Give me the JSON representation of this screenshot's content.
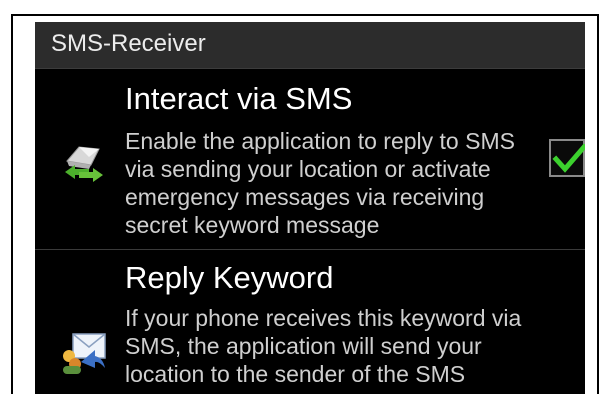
{
  "header": {
    "title": "SMS-Receiver"
  },
  "preferences": [
    {
      "title": "Interact via SMS",
      "summary": "Enable the application to reply to SMS\nvia sending your location or activate\nemergency messages via receiving\nsecret keyword message",
      "icon": "sms-exchange-icon",
      "checked": true
    },
    {
      "title": "Reply Keyword",
      "summary": "If your phone receives this keyword via\nSMS, the application will send your\nlocation to the sender of the SMS",
      "icon": "reply-mail-icon"
    }
  ],
  "colors": {
    "header_bg": "#2c2c2c",
    "background": "#000000",
    "check_accent": "#3cd12e"
  }
}
